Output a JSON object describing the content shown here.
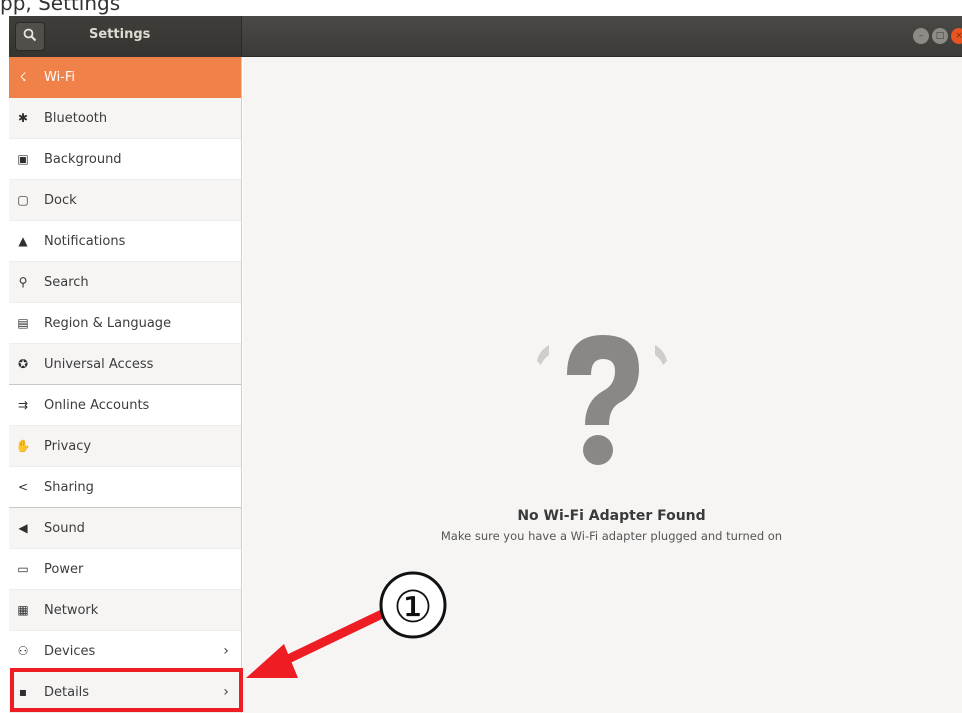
{
  "app": {
    "title": "Settings",
    "top_partial_text": "pp, Settings"
  },
  "titlebar": {
    "search_icon": "search-icon",
    "window_controls": [
      "minimize",
      "maximize",
      "close"
    ]
  },
  "sidebar": {
    "items": [
      {
        "label": "Wi-Fi",
        "icon": "wifi-icon",
        "glyph": "☇",
        "selected": true
      },
      {
        "label": "Bluetooth",
        "icon": "bluetooth-icon",
        "glyph": "✱"
      },
      {
        "label": "Background",
        "icon": "background-icon",
        "glyph": "▣"
      },
      {
        "label": "Dock",
        "icon": "dock-icon",
        "glyph": "▢"
      },
      {
        "label": "Notifications",
        "icon": "notifications-icon",
        "glyph": "▲"
      },
      {
        "label": "Search",
        "icon": "search-icon",
        "glyph": "⚲"
      },
      {
        "label": "Region & Language",
        "icon": "region-icon",
        "glyph": "▤"
      },
      {
        "label": "Universal Access",
        "icon": "universal-access-icon",
        "glyph": "✪"
      },
      {
        "label": "Online Accounts",
        "icon": "online-accounts-icon",
        "glyph": "⇉"
      },
      {
        "label": "Privacy",
        "icon": "privacy-icon",
        "glyph": "✋"
      },
      {
        "label": "Sharing",
        "icon": "sharing-icon",
        "glyph": "<"
      },
      {
        "label": "Sound",
        "icon": "sound-icon",
        "glyph": "◀"
      },
      {
        "label": "Power",
        "icon": "power-icon",
        "glyph": "▭"
      },
      {
        "label": "Network",
        "icon": "network-icon",
        "glyph": "▦"
      },
      {
        "label": "Devices",
        "icon": "devices-icon",
        "glyph": "⚇",
        "chevron": "›"
      },
      {
        "label": "Details",
        "icon": "details-icon",
        "glyph": "▪",
        "chevron": "›"
      }
    ]
  },
  "main": {
    "title": "No Wi-Fi Adapter Found",
    "subtitle": "Make sure you have a Wi-Fi adapter plugged and turned on"
  },
  "annotation": {
    "marker": "①",
    "color": "#ee1d23"
  },
  "colors": {
    "accent": "#f08149",
    "titlebar": "#3c3b37",
    "close": "#e95420",
    "annotation": "#ee1d23"
  }
}
